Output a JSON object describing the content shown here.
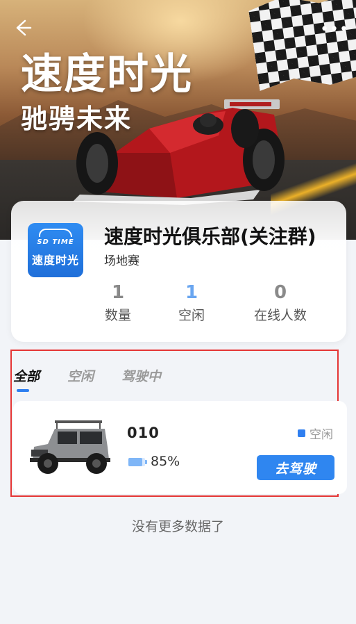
{
  "banner": {
    "title": "速度时光",
    "subtitle": "驰骋未来",
    "back_icon": "arrow-left-icon",
    "more_icon": "more-dots-icon"
  },
  "club": {
    "name": "速度时光俱乐部(关注群)",
    "type": "场地赛",
    "logo_small": "SD TIME",
    "logo_text": "速度时光",
    "stats": [
      {
        "value": "1",
        "label": "数量"
      },
      {
        "value": "1",
        "label": "空闲"
      },
      {
        "value": "0",
        "label": "在线人数"
      }
    ]
  },
  "tabs": [
    {
      "label": "全部",
      "active": true
    },
    {
      "label": "空闲",
      "active": false
    },
    {
      "label": "驾驶中",
      "active": false
    }
  ],
  "vehicles": [
    {
      "name": "010",
      "battery": "85%",
      "battery_level": 0.85,
      "status": "空闲",
      "action_label": "去驾驶"
    }
  ],
  "footer": {
    "no_more": "没有更多数据了"
  },
  "colors": {
    "accent": "#2f86f0",
    "highlight_border": "#e53535",
    "background": "#f2f4f8"
  }
}
